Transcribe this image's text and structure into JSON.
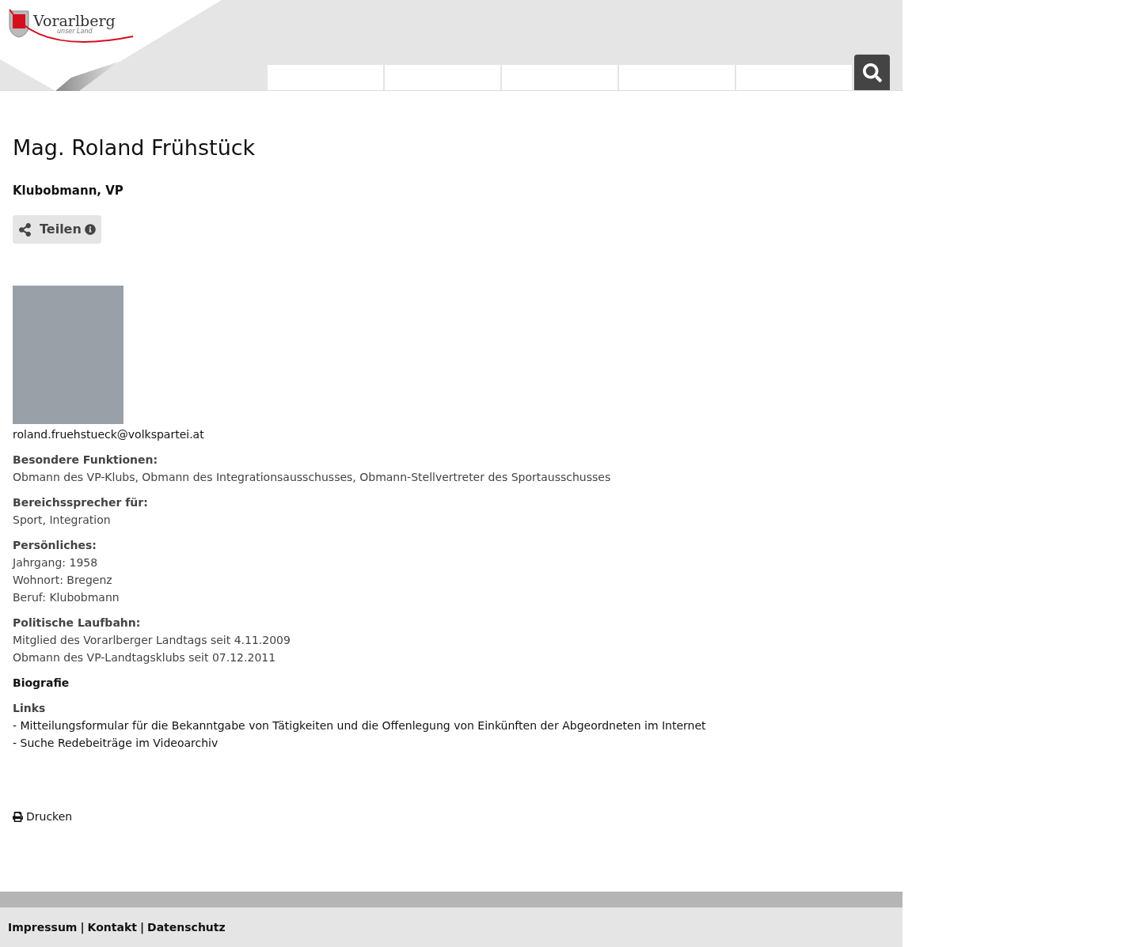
{
  "header": {
    "logo": {
      "name": "Vorarlberg",
      "tagline": "unser Land"
    }
  },
  "person": {
    "name": "Mag. Roland Frühstück",
    "role": "Klubobmann, VP",
    "share": "Teilen",
    "email": "roland.fruehstueck@volkspartei.at"
  },
  "sections": [
    {
      "heading": "Besondere Funktionen:",
      "lines": [
        "Obmann des VP-Klubs, Obmann des Integrationsausschusses, Obmann-Stellvertreter des Sportausschusses"
      ]
    },
    {
      "heading": "Bereichssprecher für:",
      "lines": [
        "Sport, Integration"
      ]
    },
    {
      "heading": "Persönliches:",
      "lines": [
        "Jahrgang: 1958",
        "Wohnort: Bregenz",
        "Beruf: Klubobmann"
      ]
    },
    {
      "heading": "Politische Laufbahn:",
      "lines": [
        "Mitglied des Vorarlberger Landtags seit 4.11.2009",
        "Obmann des VP-Landtagsklubs seit 07.12.2011"
      ]
    }
  ],
  "biografie": "Biografie",
  "links": {
    "heading": "Links",
    "prefix": "- ",
    "items": [
      "Mitteilungsformular für die Bekanntgabe von Tätigkeiten und die Offenlegung von Einkünften der Abgeordneten im Internet",
      "Suche Redebeiträge im Videoarchiv"
    ]
  },
  "print": "Drucken",
  "footer": {
    "links": [
      "Impressum",
      "Kontakt",
      "Datenschutz"
    ],
    "separator": "|"
  }
}
